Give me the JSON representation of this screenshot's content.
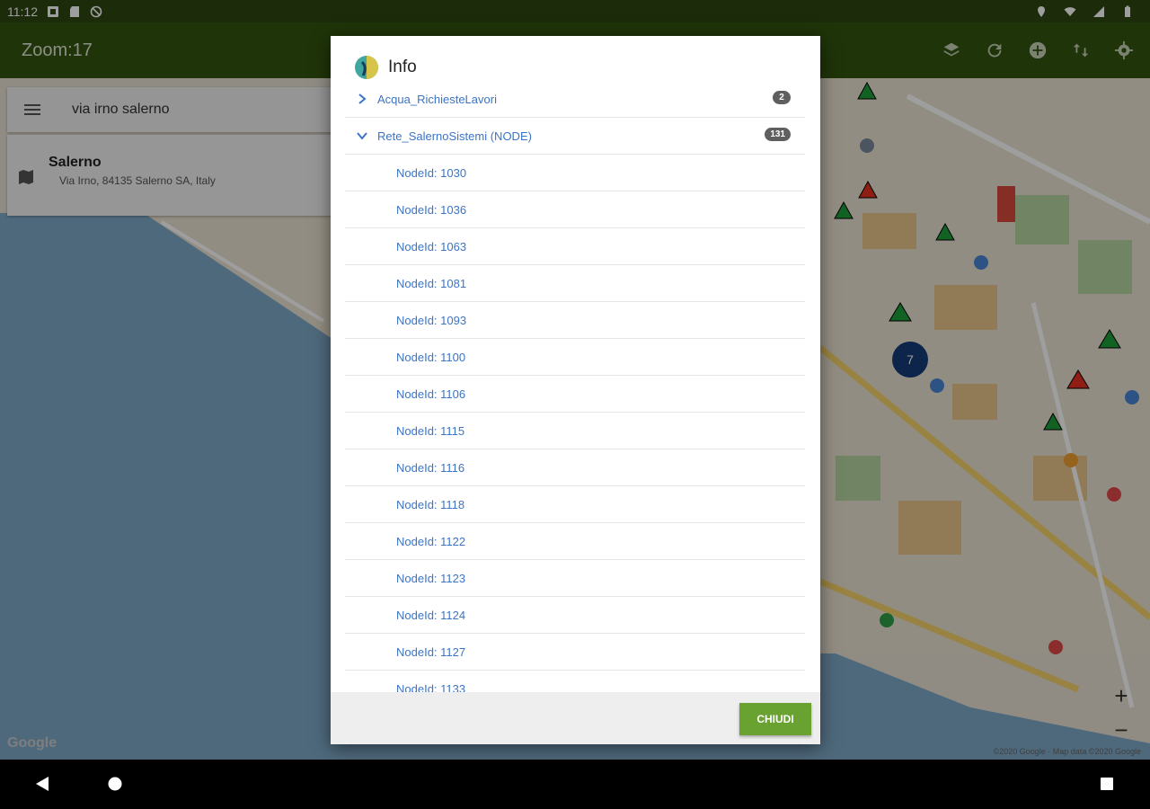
{
  "status_bar": {
    "time": "11:12"
  },
  "app_bar": {
    "title": "Zoom:17",
    "actions": [
      "layers-icon",
      "refresh-icon",
      "add-circle-icon",
      "swap-vertical-icon",
      "settings-icon"
    ]
  },
  "search": {
    "query": "via irno salerno"
  },
  "search_result": {
    "title": "Salerno",
    "address": "Via Irno, 84135 Salerno SA, Italy"
  },
  "map": {
    "cluster_count": "7",
    "attribution": "Google",
    "copyright": "©2020 Google · Map data ©2020 Google"
  },
  "zoom_controls": {
    "plus": "+",
    "minus": "−"
  },
  "dialog": {
    "title": "Info",
    "groups": [
      {
        "label": "Acqua_RichiesteLavori",
        "count": "2",
        "expanded": false
      },
      {
        "label": "Rete_SalernoSistemi (NODE)",
        "count": "131",
        "expanded": true
      }
    ],
    "nodes": [
      "NodeId: 1030",
      "NodeId: 1036",
      "NodeId: 1063",
      "NodeId: 1081",
      "NodeId: 1093",
      "NodeId: 1100",
      "NodeId: 1106",
      "NodeId: 1115",
      "NodeId: 1116",
      "NodeId: 1118",
      "NodeId: 1122",
      "NodeId: 1123",
      "NodeId: 1124",
      "NodeId: 1127",
      "NodeId: 1133"
    ],
    "close_label": "CHIUDI"
  },
  "colors": {
    "status_bar": "#2e4712",
    "app_bar": "#33550f",
    "link_text": "#3c74c5",
    "badge": "#5f5f5f",
    "close_button": "#6aa232"
  }
}
